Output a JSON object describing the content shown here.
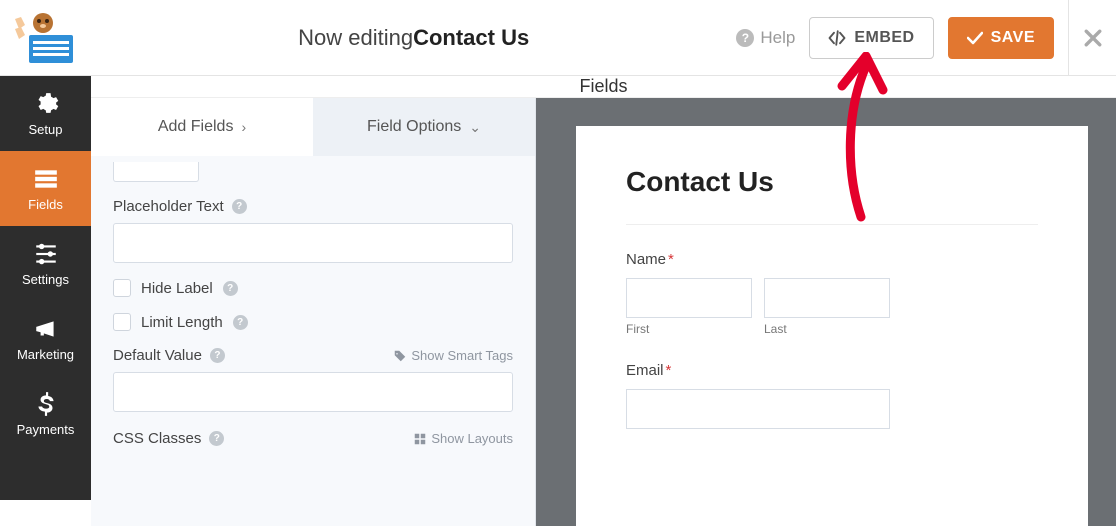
{
  "header": {
    "title_prefix": "Now editing ",
    "title_form": "Contact Us",
    "help_label": "Help",
    "embed_label": "EMBED",
    "save_label": "SAVE"
  },
  "sidebar": {
    "items": [
      {
        "label": "Setup",
        "icon": "gear-icon"
      },
      {
        "label": "Fields",
        "icon": "list-icon"
      },
      {
        "label": "Settings",
        "icon": "sliders-icon"
      },
      {
        "label": "Marketing",
        "icon": "bullhorn-icon"
      },
      {
        "label": "Payments",
        "icon": "dollar-icon"
      }
    ],
    "active": 1
  },
  "panel": {
    "title": "Fields"
  },
  "tabs": {
    "add_fields": "Add Fields",
    "field_options": "Field Options"
  },
  "options": {
    "placeholder_label": "Placeholder Text",
    "placeholder_value": "",
    "hide_label": "Hide Label",
    "limit_length": "Limit Length",
    "default_value_label": "Default Value",
    "default_value_value": "",
    "smart_tags": "Show Smart Tags",
    "css_classes_label": "CSS Classes",
    "show_layouts": "Show Layouts"
  },
  "preview": {
    "form_title": "Contact Us",
    "name_label": "Name",
    "first_label": "First",
    "last_label": "Last",
    "email_label": "Email",
    "required_marker": "*"
  }
}
